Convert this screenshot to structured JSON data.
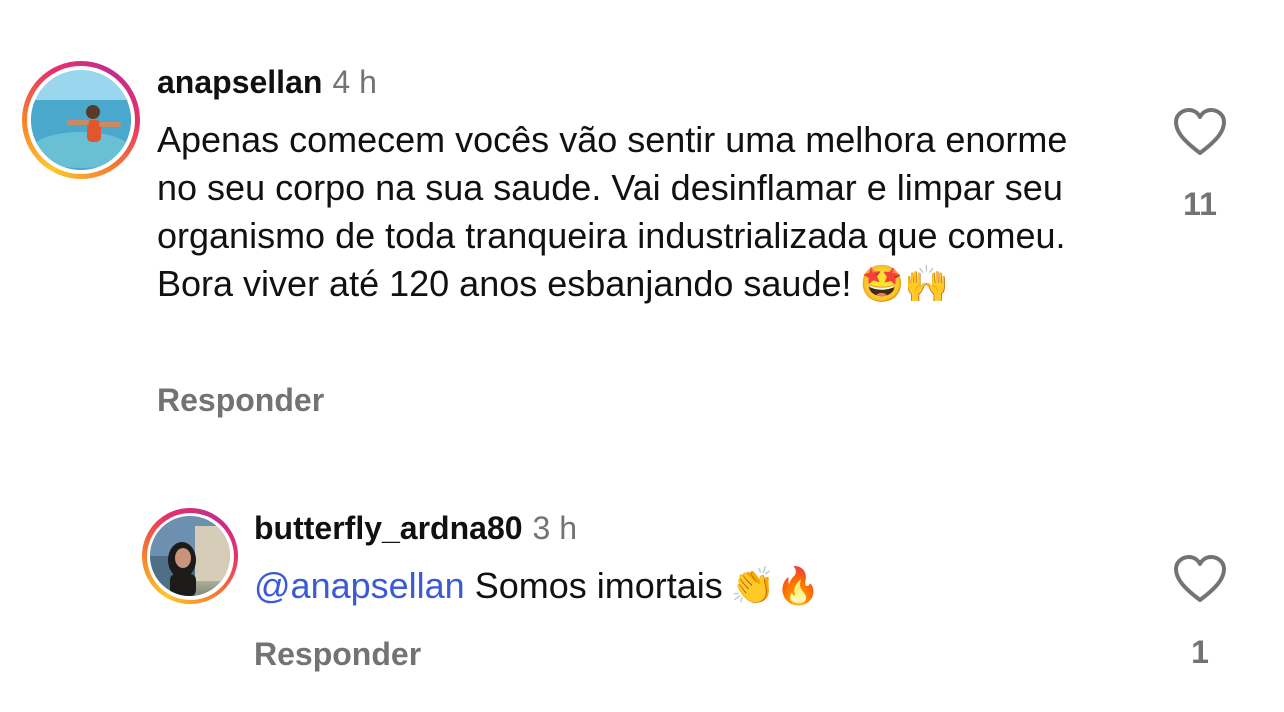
{
  "comments": [
    {
      "username": "anapsellan",
      "timestamp": "4 h",
      "mention": "",
      "text": "Apenas comecem vocês vão sentir uma melhora enorme no seu corpo na sua saude. Vai desinflamar e limpar seu organismo de toda tranqueira industrializada que comeu. Bora viver até 120 anos esbanjando saude!",
      "emojis": "🤩🙌",
      "reply_label": "Responder",
      "like_count": "11",
      "icon": "heart-outline-icon"
    },
    {
      "username": "butterfly_ardna80",
      "timestamp": "3 h",
      "mention": "@anapsellan",
      "text": "Somos imortais",
      "emojis": "👏🔥",
      "reply_label": "Responder",
      "like_count": "1",
      "icon": "heart-outline-icon"
    }
  ],
  "colors": {
    "text": "#111111",
    "muted": "#737373",
    "mention": "#3b5bd5",
    "story_ring": [
      "#fdc72d",
      "#f6812b",
      "#e6306b",
      "#c22e8d"
    ]
  }
}
